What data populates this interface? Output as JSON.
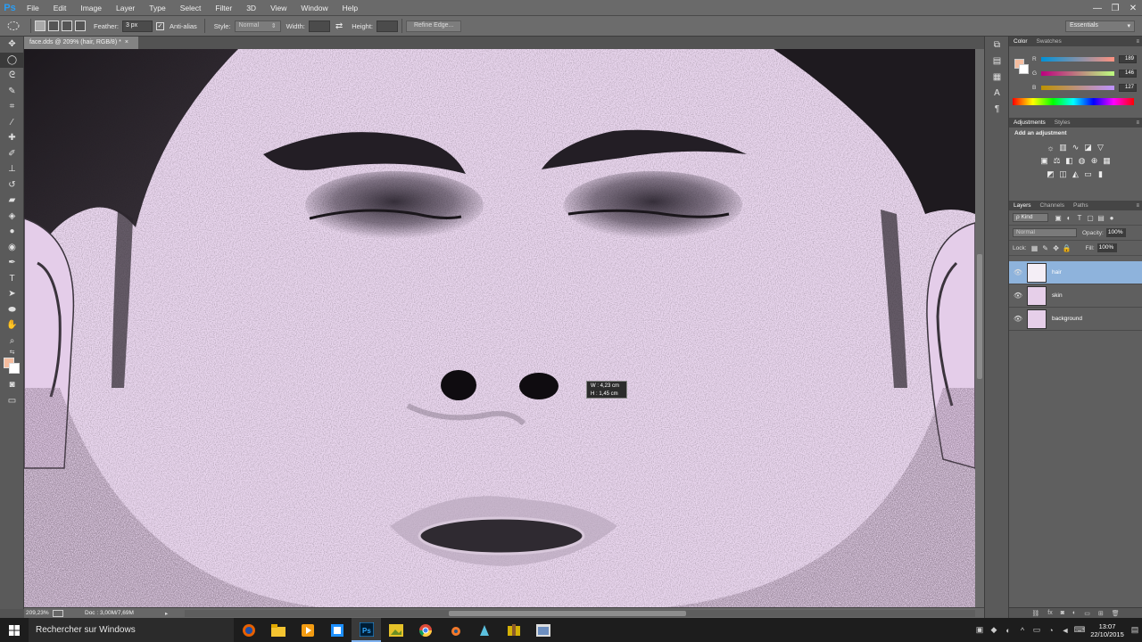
{
  "app": {
    "logo": "Ps"
  },
  "menu": [
    "File",
    "Edit",
    "Image",
    "Layer",
    "Type",
    "Select",
    "Filter",
    "3D",
    "View",
    "Window",
    "Help"
  ],
  "window_controls": {
    "minimize": "—",
    "maximize": "❐",
    "close": "✕"
  },
  "options": {
    "feather_label": "Feather:",
    "feather_value": "3 px",
    "antialias_label": "Anti-alias",
    "style_label": "Style:",
    "style_value": "Normal",
    "width_label": "Width:",
    "height_label": "Height:",
    "refine_label": "Refine Edge...",
    "workspace": "Essentials"
  },
  "document": {
    "tab_title": "face.dds @ 209% (hair, RGB/8) *",
    "close_glyph": "×",
    "measure_w": "W :  4,23 cm",
    "measure_h": "H :  1,45 cm"
  },
  "status": {
    "zoom": "209,23%",
    "doc_info": "Doc : 3,00M/7,69M",
    "arrow": "▸"
  },
  "color_panel": {
    "tabs": [
      "Color",
      "Swatches"
    ],
    "fg_color": "#f5bd9f",
    "r_label": "R",
    "r_value": "189",
    "g_label": "G",
    "g_value": "146",
    "b_label": "B",
    "b_value": "127"
  },
  "adjustments_panel": {
    "tabs": [
      "Adjustments",
      "Styles"
    ],
    "title": "Add an adjustment"
  },
  "layers_panel": {
    "tabs": [
      "Layers",
      "Channels",
      "Paths"
    ],
    "kind_label": "ρ Kind",
    "blend_mode": "Normal",
    "opacity_label": "Opacity:",
    "opacity_value": "100%",
    "lock_label": "Lock:",
    "fill_label": "Fill:",
    "fill_value": "100%",
    "layers": [
      {
        "name": "hair",
        "selected": true
      },
      {
        "name": "skin",
        "selected": false
      },
      {
        "name": "background",
        "selected": false
      }
    ]
  },
  "taskbar": {
    "search_placeholder": "Rechercher sur Windows",
    "time": "13:07",
    "date": "22/10/2015"
  }
}
